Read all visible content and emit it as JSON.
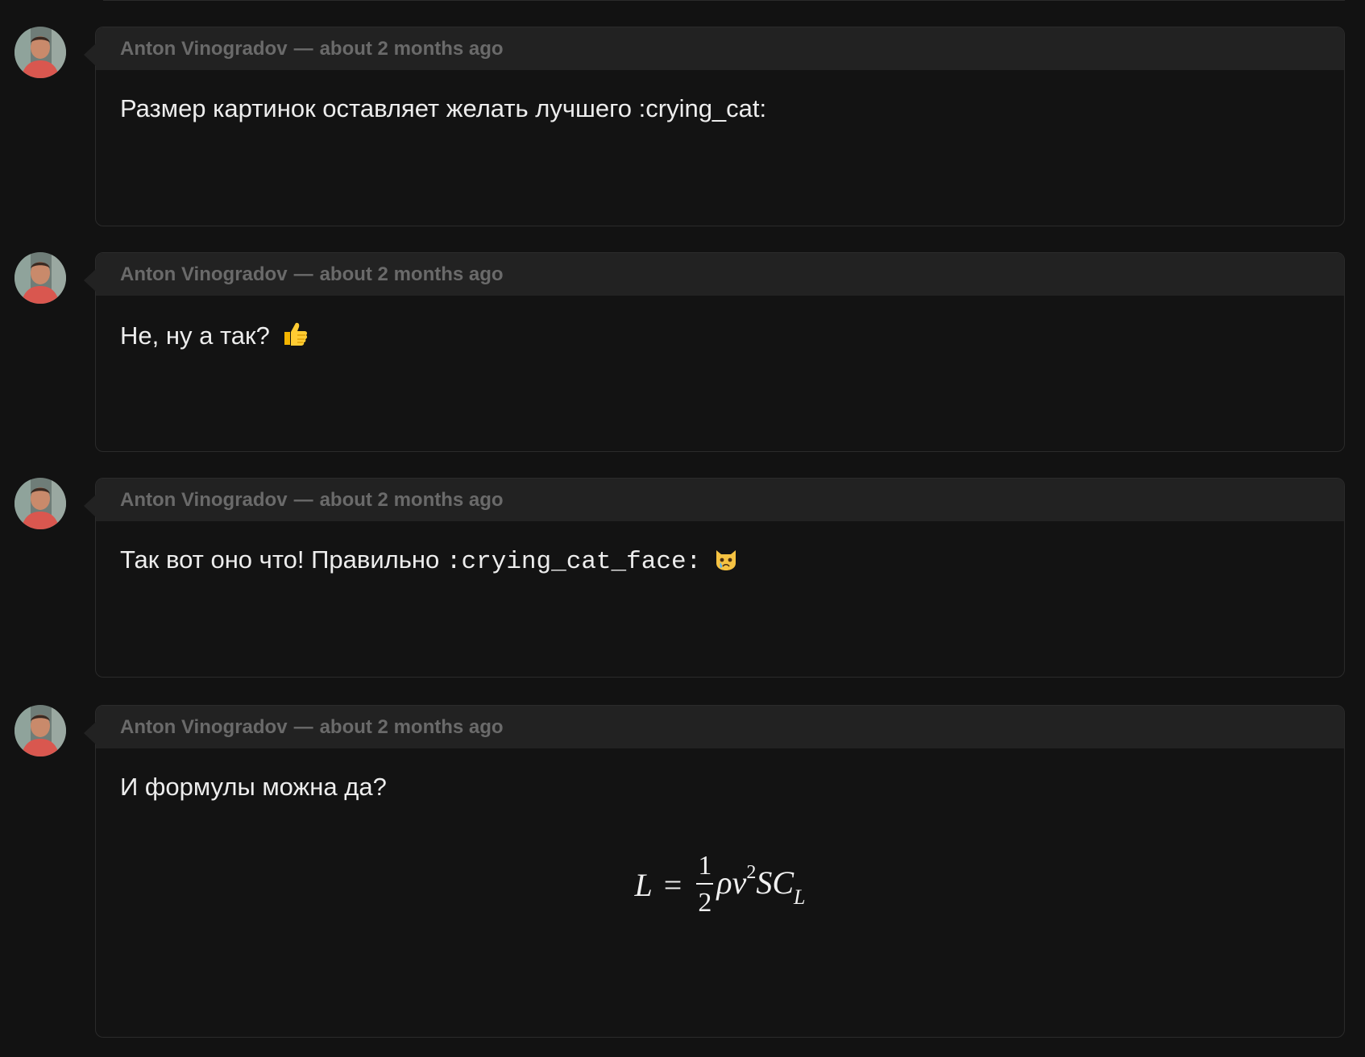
{
  "comments": [
    {
      "author": "Anton Vinogradov",
      "separator": "—",
      "time": "about 2 months ago",
      "text": "Размер картинок оставляет желать лучшего :crying_cat:"
    },
    {
      "author": "Anton Vinogradov",
      "separator": "—",
      "time": "about 2 months ago",
      "text": "Не, ну а так?",
      "emoji": "thumbs-up"
    },
    {
      "author": "Anton Vinogradov",
      "separator": "—",
      "time": "about 2 months ago",
      "text": "Так вот оно что! Правильно",
      "code": ":crying_cat_face:",
      "emoji": "crying-cat-face"
    },
    {
      "author": "Anton Vinogradov",
      "separator": "—",
      "time": "about 2 months ago",
      "text": "И формулы можна да?",
      "formula": {
        "lhs": "L",
        "eq": "=",
        "numerator": "1",
        "denominator": "2",
        "rho": "ρ",
        "v": "v",
        "v_exp": "2",
        "s_c": "SC",
        "sub": "L"
      }
    }
  ],
  "colors": {
    "background": "#121212",
    "card_header": "#222222",
    "meta_text": "#6a6a6a",
    "body_text": "#ededed"
  }
}
